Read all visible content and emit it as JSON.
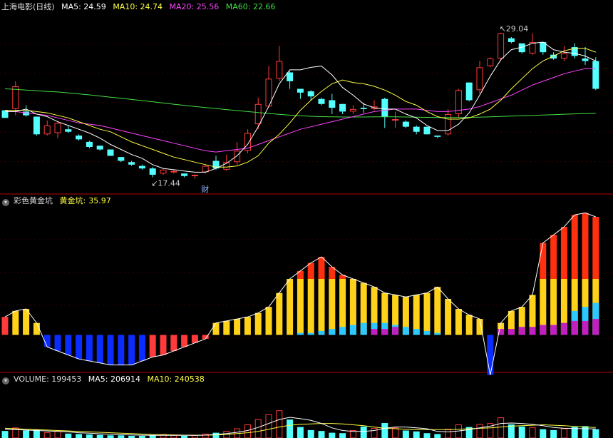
{
  "panes": {
    "price": {
      "title": "上海电影(日线)",
      "indicators": [
        {
          "label": "MA5: 24.59",
          "color": "#ffffff"
        },
        {
          "label": "MA10: 24.74",
          "color": "#ffff44"
        },
        {
          "label": "MA20: 25.56",
          "color": "#ff44ff"
        },
        {
          "label": "MA60: 22.66",
          "color": "#44dd44"
        }
      ],
      "high_label": "29.04",
      "low_label": "17.44",
      "event_marker": "财"
    },
    "gold": {
      "title": "彩色黄金坑",
      "indicator_name": "黄金坑",
      "indicator_value": "35.97"
    },
    "volume": {
      "title": "VOLUME: 199453",
      "ma5": "MA5: 206914",
      "ma10": "MA10: 240538"
    }
  },
  "colors": {
    "up": "#ff3a3a",
    "down": "#54ffff",
    "ma5": "#ffffff",
    "ma10": "#ffff44",
    "ma20": "#ff44ff",
    "ma60": "#44dd44",
    "separator": "#b00000",
    "gold_yellow": "#ffd21a",
    "gold_red": "#ff3010",
    "gold_blue": "#0a2cff",
    "gold_cyan": "#2ec8ff",
    "gold_magenta": "#c020c0"
  },
  "chart_data": [
    {
      "type": "candlestick",
      "x_count": 57,
      "ylim": [
        16.5,
        30.5
      ],
      "candles": [
        [
          22.9,
          22.3,
          22.8,
          22.6
        ],
        [
          23.0,
          24.8,
          25.2,
          22.5
        ],
        [
          22.8,
          22.5,
          23.3,
          22.4
        ],
        [
          22.4,
          21.0,
          22.4,
          20.9
        ],
        [
          21.0,
          21.7,
          22.1,
          20.9
        ],
        [
          21.1,
          21.9,
          22.0,
          20.7
        ],
        [
          21.4,
          21.2,
          21.7,
          21.1
        ],
        [
          20.9,
          20.6,
          21.0,
          20.5
        ],
        [
          20.4,
          20.0,
          20.5,
          19.9
        ],
        [
          20.1,
          19.8,
          20.1,
          19.7
        ],
        [
          19.8,
          19.3,
          19.8,
          19.3
        ],
        [
          19.2,
          18.9,
          19.2,
          18.8
        ],
        [
          18.8,
          18.6,
          18.9,
          18.5
        ],
        [
          18.5,
          18.3,
          18.6,
          18.2
        ],
        [
          18.3,
          17.8,
          18.4,
          17.6
        ],
        [
          17.9,
          18.2,
          18.3,
          17.8
        ],
        [
          18.0,
          18.1,
          18.2,
          17.9
        ],
        [
          17.9,
          17.7,
          17.9,
          17.6
        ],
        [
          17.7,
          17.8,
          17.8,
          17.5
        ],
        [
          18.0,
          18.5,
          18.6,
          17.9
        ],
        [
          18.9,
          18.3,
          19.3,
          18.2
        ],
        [
          18.2,
          18.8,
          19.4,
          18.1
        ],
        [
          18.8,
          19.7,
          20.4,
          18.6
        ],
        [
          19.7,
          21.1,
          21.4,
          19.5
        ],
        [
          21.8,
          23.4,
          23.9,
          21.4
        ],
        [
          23.2,
          25.4,
          26.4,
          23.1
        ],
        [
          25.4,
          26.8,
          28.0,
          25.2
        ],
        [
          25.9,
          25.2,
          26.0,
          24.6
        ],
        [
          24.6,
          24.3,
          24.6,
          23.8
        ],
        [
          24.4,
          24.0,
          24.5,
          23.7
        ],
        [
          23.8,
          23.4,
          23.9,
          23.3
        ],
        [
          23.7,
          23.1,
          24.2,
          22.6
        ],
        [
          23.4,
          22.8,
          23.4,
          22.6
        ],
        [
          22.8,
          23.0,
          23.3,
          22.6
        ],
        [
          23.1,
          23.0,
          23.5,
          22.7
        ],
        [
          23.0,
          23.2,
          23.7,
          22.9
        ],
        [
          23.8,
          22.4,
          23.9,
          21.5
        ],
        [
          22.2,
          22.2,
          22.8,
          21.5
        ],
        [
          22.0,
          21.6,
          22.1,
          21.5
        ],
        [
          21.6,
          21.2,
          21.7,
          21.0
        ],
        [
          21.6,
          21.0,
          21.6,
          21.0
        ],
        [
          20.9,
          20.8,
          20.9,
          20.7
        ],
        [
          21.0,
          22.6,
          23.0,
          20.9
        ],
        [
          22.6,
          24.5,
          24.6,
          22.3
        ],
        [
          25.1,
          23.7,
          25.1,
          23.6
        ],
        [
          24.5,
          26.3,
          26.8,
          24.2
        ],
        [
          26.4,
          27.0,
          27.1,
          26.3
        ],
        [
          27.0,
          29.0,
          29.04,
          26.8
        ],
        [
          28.6,
          28.3,
          28.7,
          28.2
        ],
        [
          28.2,
          27.5,
          28.2,
          27.4
        ],
        [
          27.4,
          28.3,
          29.0,
          27.3
        ],
        [
          28.3,
          27.5,
          28.3,
          27.3
        ],
        [
          27.3,
          27.0,
          27.5,
          26.9
        ],
        [
          27.0,
          27.4,
          28.0,
          26.8
        ],
        [
          27.9,
          27.2,
          28.2,
          27.0
        ],
        [
          27.0,
          26.8,
          27.9,
          26.5
        ],
        [
          26.8,
          24.6,
          27.1,
          24.5
        ]
      ],
      "ma5": [
        22.8,
        22.8,
        23.0,
        22.6,
        22.4,
        22.0,
        21.7,
        21.4,
        21.1,
        20.7,
        20.2,
        19.8,
        19.4,
        19.1,
        18.6,
        18.3,
        18.2,
        18.1,
        18.0,
        18.0,
        18.3,
        18.7,
        19.3,
        20.2,
        21.6,
        23.2,
        25.0,
        26.1,
        26.1,
        26.3,
        26.4,
        25.7,
        24.7,
        24.1,
        23.4,
        23.1,
        23.0,
        23.0,
        22.6,
        22.3,
        21.7,
        21.3,
        21.3,
        21.8,
        22.7,
        24.1,
        25.6,
        26.9,
        27.7,
        27.9,
        28.2,
        28.3,
        27.7,
        27.5,
        27.4,
        27.2,
        26.8
      ],
      "ma10": [
        22.9,
        22.9,
        22.9,
        22.8,
        22.7,
        22.5,
        22.3,
        22.0,
        21.7,
        21.4,
        21.2,
        20.8,
        20.4,
        20.1,
        19.8,
        19.5,
        19.2,
        19.0,
        18.8,
        18.6,
        18.4,
        18.4,
        18.5,
        18.8,
        19.3,
        20.3,
        21.0,
        21.9,
        22.9,
        23.7,
        24.4,
        25.0,
        25.3,
        25.1,
        25.0,
        24.8,
        24.5,
        24.1,
        23.6,
        23.3,
        22.8,
        22.4,
        22.2,
        22.2,
        22.3,
        22.6,
        23.0,
        23.7,
        24.6,
        25.4,
        26.2,
        26.8,
        27.2,
        27.6,
        27.8,
        27.8,
        27.5
      ],
      "ma20": [
        22.8,
        22.8,
        22.7,
        22.6,
        22.5,
        22.3,
        22.1,
        21.9,
        21.8,
        21.7,
        21.5,
        21.3,
        21.1,
        20.9,
        20.7,
        20.5,
        20.3,
        20.1,
        19.9,
        19.7,
        19.6,
        19.7,
        19.8,
        19.9,
        20.2,
        20.5,
        20.8,
        21.1,
        21.4,
        21.6,
        21.8,
        22.0,
        22.2,
        22.4,
        22.6,
        22.8,
        22.9,
        23.0,
        23.0,
        23.0,
        22.9,
        22.8,
        22.8,
        22.9,
        23.0,
        23.2,
        23.5,
        23.8,
        24.1,
        24.5,
        24.9,
        25.2,
        25.5,
        25.8,
        26.0,
        26.2,
        26.2
      ],
      "ma60": [
        24.6,
        24.56,
        24.5,
        24.45,
        24.4,
        24.35,
        24.28,
        24.2,
        24.12,
        24.03,
        23.94,
        23.85,
        23.76,
        23.67,
        23.58,
        23.48,
        23.38,
        23.29,
        23.2,
        23.12,
        23.04,
        22.96,
        22.88,
        22.8,
        22.72,
        22.65,
        22.58,
        22.52,
        22.47,
        22.43,
        22.4,
        22.38,
        22.37,
        22.37,
        22.37,
        22.38,
        22.38,
        22.38,
        22.37,
        22.36,
        22.34,
        22.33,
        22.33,
        22.33,
        22.34,
        22.36,
        22.38,
        22.41,
        22.44,
        22.47,
        22.5,
        22.53,
        22.56,
        22.59,
        22.62,
        22.64,
        22.66
      ]
    },
    {
      "type": "bar",
      "title": "彩色黄金坑",
      "series_name": "黄金坑",
      "last_value": 35.97,
      "ylim": [
        -18,
        64
      ],
      "values": [
        9,
        12,
        13,
        6,
        -6,
        -8,
        -10,
        -12,
        -13,
        -14,
        -15,
        -15,
        -15,
        -13,
        -11,
        -10,
        -8,
        -6,
        -4,
        -2,
        6,
        7,
        8,
        9,
        11,
        14,
        21,
        28,
        32,
        36,
        39,
        34,
        30,
        28,
        26,
        24,
        21,
        20,
        19,
        20,
        21,
        24,
        18,
        13,
        10,
        8,
        -20,
        6,
        12,
        14,
        20,
        46,
        50,
        54,
        60,
        61,
        59
      ],
      "cyan_component": [
        0,
        0,
        0,
        0,
        0,
        0,
        0,
        0,
        0,
        0,
        0,
        0,
        0,
        0,
        0,
        0,
        0,
        0,
        0,
        0,
        0,
        0,
        0,
        0,
        0,
        0,
        0,
        0,
        1,
        1,
        2,
        3,
        4,
        5,
        6,
        6,
        6,
        5,
        4,
        3,
        2,
        1,
        0,
        0,
        0,
        0,
        0,
        0,
        0,
        0,
        0,
        0,
        0,
        0,
        12,
        14,
        16,
        17,
        18,
        19,
        20
      ],
      "magenta_component": [
        0,
        0,
        0,
        0,
        0,
        0,
        0,
        0,
        0,
        0,
        0,
        0,
        0,
        0,
        0,
        0,
        0,
        0,
        0,
        0,
        0,
        0,
        0,
        0,
        0,
        0,
        0,
        0,
        0,
        0,
        0,
        0,
        0,
        0,
        0,
        3,
        3,
        4,
        0,
        0,
        0,
        0,
        0,
        0,
        0,
        0,
        0,
        3,
        3,
        4,
        4,
        5,
        5,
        6,
        7,
        7,
        8
      ]
    },
    {
      "type": "bar",
      "title": "VOLUME",
      "last_value": 199453,
      "ma5_last": 206914,
      "ma10_last": 240538,
      "ylim": [
        0,
        1200000
      ],
      "values": [
        160000,
        230000,
        170000,
        190000,
        120000,
        150000,
        100000,
        90000,
        80000,
        70000,
        60000,
        60000,
        50000,
        50000,
        60000,
        80000,
        60000,
        50000,
        60000,
        90000,
        120000,
        150000,
        210000,
        300000,
        420000,
        530000,
        620000,
        420000,
        250000,
        180000,
        160000,
        120000,
        110000,
        170000,
        260000,
        220000,
        340000,
        230000,
        170000,
        150000,
        110000,
        90000,
        200000,
        300000,
        250000,
        310000,
        330000,
        460000,
        310000,
        260000,
        240000,
        200000,
        180000,
        210000,
        250000,
        270000,
        199453
      ],
      "ma5": [
        200000,
        190000,
        180000,
        170000,
        160000,
        150000,
        140000,
        120000,
        110000,
        95000,
        85000,
        75000,
        70000,
        65000,
        62000,
        62000,
        60000,
        60000,
        62000,
        65000,
        80000,
        100000,
        130000,
        170000,
        240000,
        330000,
        420000,
        470000,
        440000,
        400000,
        330000,
        230000,
        170000,
        150000,
        150000,
        170000,
        220000,
        250000,
        250000,
        230000,
        210000,
        150000,
        140000,
        160000,
        190000,
        230000,
        270000,
        330000,
        340000,
        330000,
        310000,
        280000,
        240000,
        220000,
        215000,
        210000,
        206914
      ],
      "ma10": [
        220000,
        210000,
        200000,
        190000,
        180000,
        170000,
        160000,
        150000,
        140000,
        130000,
        120000,
        110000,
        100000,
        90000,
        80000,
        75000,
        70000,
        65000,
        64000,
        65000,
        70000,
        80000,
        100000,
        120000,
        150000,
        200000,
        250000,
        290000,
        310000,
        320000,
        330000,
        330000,
        320000,
        300000,
        280000,
        250000,
        220000,
        210000,
        200000,
        190000,
        190000,
        190000,
        190000,
        200000,
        210000,
        220000,
        230000,
        250000,
        270000,
        280000,
        290000,
        300000,
        290000,
        280000,
        265000,
        250000,
        240538
      ]
    }
  ]
}
